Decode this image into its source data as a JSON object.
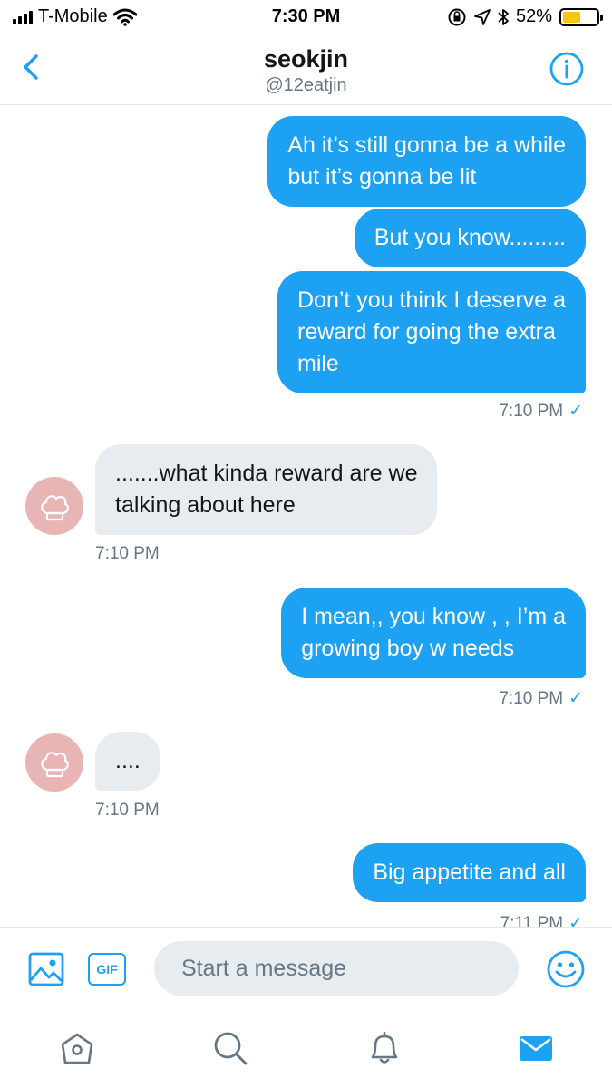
{
  "status_bar": {
    "carrier": "T-Mobile",
    "time": "7:30 PM",
    "battery": "52%",
    "battery_level": 0.52,
    "icons": [
      "signal-icon",
      "wifi-icon",
      "orientation-lock-icon",
      "location-icon",
      "bluetooth-icon",
      "battery-icon"
    ]
  },
  "header": {
    "back_icon": "chevron-left-icon",
    "name": "seokjin",
    "handle": "@12eatjin",
    "info_icon": "info-icon"
  },
  "messages": [
    {
      "direction": "sent",
      "text": "Ah it’s still gonna be a while\nbut it’s gonna be lit"
    },
    {
      "direction": "sent",
      "text": "But you know........."
    },
    {
      "direction": "sent",
      "text": "Don’t you think I deserve a\nreward for going the extra\nmile"
    },
    {
      "direction": "sent_time",
      "text": "7:10 PM",
      "check": "✓"
    },
    {
      "direction": "received",
      "text": ".......what kinda reward are we\ntalking about here"
    },
    {
      "direction": "received_time",
      "text": "7:10 PM"
    },
    {
      "direction": "sent",
      "text": "I mean,, you know , , I’m a\ngrowing boy w needs"
    },
    {
      "direction": "sent_time",
      "text": "7:10 PM",
      "check": "✓"
    },
    {
      "direction": "received",
      "text": "...."
    },
    {
      "direction": "received_time",
      "text": "7:10 PM"
    },
    {
      "direction": "sent",
      "text": "Big appetite and all"
    },
    {
      "direction": "sent_time",
      "text": "7:11 PM",
      "check": "✓"
    }
  ],
  "composer": {
    "media_icon": "image-icon",
    "gif_label": "GIF",
    "placeholder": "Start a message",
    "emoji_icon": "emoji-icon"
  },
  "tab_bar": {
    "tabs": [
      "home-icon",
      "search-icon",
      "notifications-icon",
      "messages-icon"
    ],
    "active": "messages-icon"
  },
  "colors": {
    "accent": "#1da1f2",
    "received_bubble": "#e6ecf0",
    "secondary_text": "#657786",
    "avatar": "#e8b5b5"
  }
}
